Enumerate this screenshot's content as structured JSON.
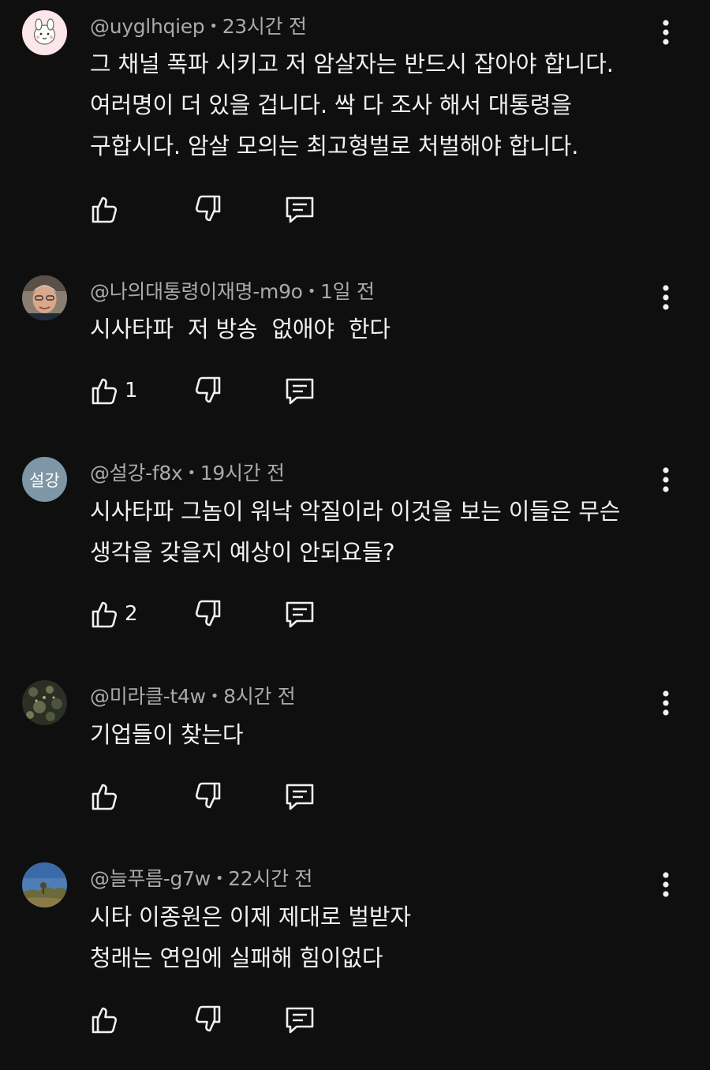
{
  "comments": [
    {
      "handle": "@uyglhqiep",
      "time": "23시간 전",
      "text": "그 채널 폭파 시키고 저 암살자는 반드시 잡아야 합니다.\n여러명이 더 있을 겁니다. 싹 다 조사 해서 대통령을\n구합시다. 암살 모의는 최고형벌로 처벌해야 합니다.",
      "likes": ""
    },
    {
      "handle": "@나의대통령이재명-m9o",
      "time": "1일 전",
      "text": "시사타파  저 방송  없애야  한다",
      "likes": "1"
    },
    {
      "handle": "@설강-f8x",
      "time": "19시간 전",
      "avatar_text": "설강",
      "text": "시사타파 그놈이 워낙 악질이라 이것을 보는 이들은 무슨\n생각을 갖을지 예상이 안되요들?",
      "likes": "2"
    },
    {
      "handle": "@미라클-t4w",
      "time": "8시간 전",
      "text": "기업들이 찾는다",
      "likes": ""
    },
    {
      "handle": "@늘푸름-g7w",
      "time": "22시간 전",
      "text": "시타 이종원은 이제 제대로 벌받자\n청래는 연임에 실패해 힘이없다",
      "likes": ""
    }
  ],
  "separator": "•",
  "icons": {
    "like": "thumb-up-icon",
    "dislike": "thumb-down-icon",
    "reply": "reply-icon",
    "more": "more-vert-icon"
  },
  "colors": {
    "background": "#0f0f0f",
    "text": "#f1f1f1",
    "meta": "#aaaaaa"
  }
}
